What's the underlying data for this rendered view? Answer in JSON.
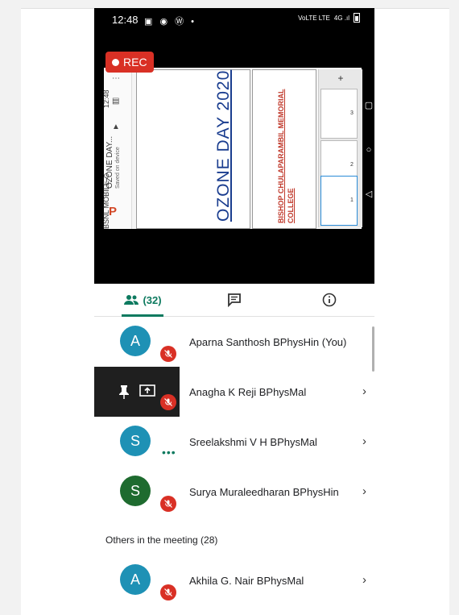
{
  "status_bar": {
    "time": "12:48",
    "icons": "▣ ◉ Ⓦ •",
    "network": "VoLTE LTE",
    "signal": "4G .ıl"
  },
  "recording": {
    "label": "REC",
    "color": "#d93025"
  },
  "presentation": {
    "app_name": "OZONE DAY...",
    "save_status": "Saved on device",
    "carrier": "BSNL MOBILE ⊙",
    "device_time": "12:48",
    "slide1_title": "OZONE DAY 2020",
    "slide2_title_line1": "BISHOP CHULAPARAMBIL MEMORIAL",
    "slide2_title_line2": "COLLEGE",
    "thumbnails": [
      "1",
      "2",
      "3"
    ],
    "add_slide": "+"
  },
  "tabs": {
    "people_count": "(32)",
    "people_icon": "people-icon",
    "chat_icon": "chat-icon",
    "info_icon": "info-icon",
    "accent": "#0d7a5f"
  },
  "participants": [
    {
      "initial": "A",
      "name": "Aparna Santhosh BPhysHin (You)",
      "avatar_color": "#1e91b5",
      "muted": true
    },
    {
      "initial": "",
      "name": "Anagha K Reji BPhysMal",
      "avatar_color": "#1f1f1f",
      "muted": true
    },
    {
      "initial": "S",
      "name": "Sreelakshmi V H BPhysMal",
      "avatar_color": "#1e91b5",
      "muted": false
    },
    {
      "initial": "S",
      "name": "Surya Muraleedharan BPhysHin",
      "avatar_color": "#1e6b2f",
      "muted": true
    }
  ],
  "others_section": {
    "label": "Others in the meeting (28)"
  },
  "others": [
    {
      "initial": "A",
      "name": "Akhila G. Nair BPhysMal",
      "avatar_color": "#1e91b5",
      "muted": true
    }
  ]
}
